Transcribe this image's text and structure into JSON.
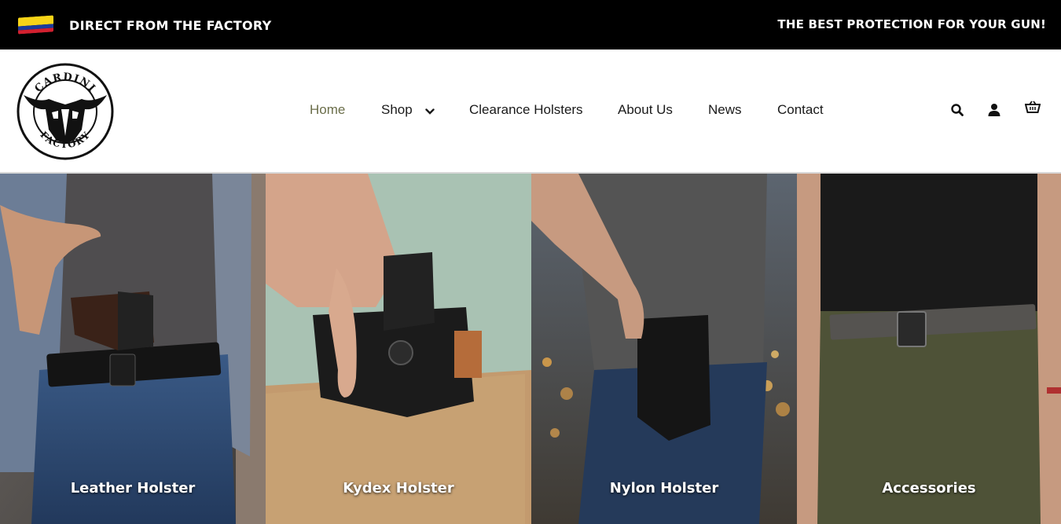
{
  "topbar": {
    "left_text": "DIRECT FROM THE FACTORY",
    "right_text": "THE BEST PROTECTION FOR YOUR GUN!",
    "flag_icon": "colombia-flag-icon"
  },
  "logo": {
    "text_top": "CARDINI",
    "text_bottom": "FACTORY"
  },
  "nav": {
    "items": [
      {
        "label": "Home",
        "active": true
      },
      {
        "label": "Shop",
        "has_dropdown": true
      },
      {
        "label": "Clearance Holsters"
      },
      {
        "label": "About Us"
      },
      {
        "label": "News"
      },
      {
        "label": "Contact"
      }
    ]
  },
  "header_icons": [
    "search-icon",
    "account-icon",
    "cart-icon"
  ],
  "categories": [
    {
      "label": "Leather Holster"
    },
    {
      "label": "Kydex Holster"
    },
    {
      "label": "Nylon Holster"
    },
    {
      "label": "Accessories"
    }
  ],
  "colors": {
    "topbar_bg": "#000000",
    "nav_active": "#6b6e4a",
    "nav_text": "#1a1a1a"
  }
}
